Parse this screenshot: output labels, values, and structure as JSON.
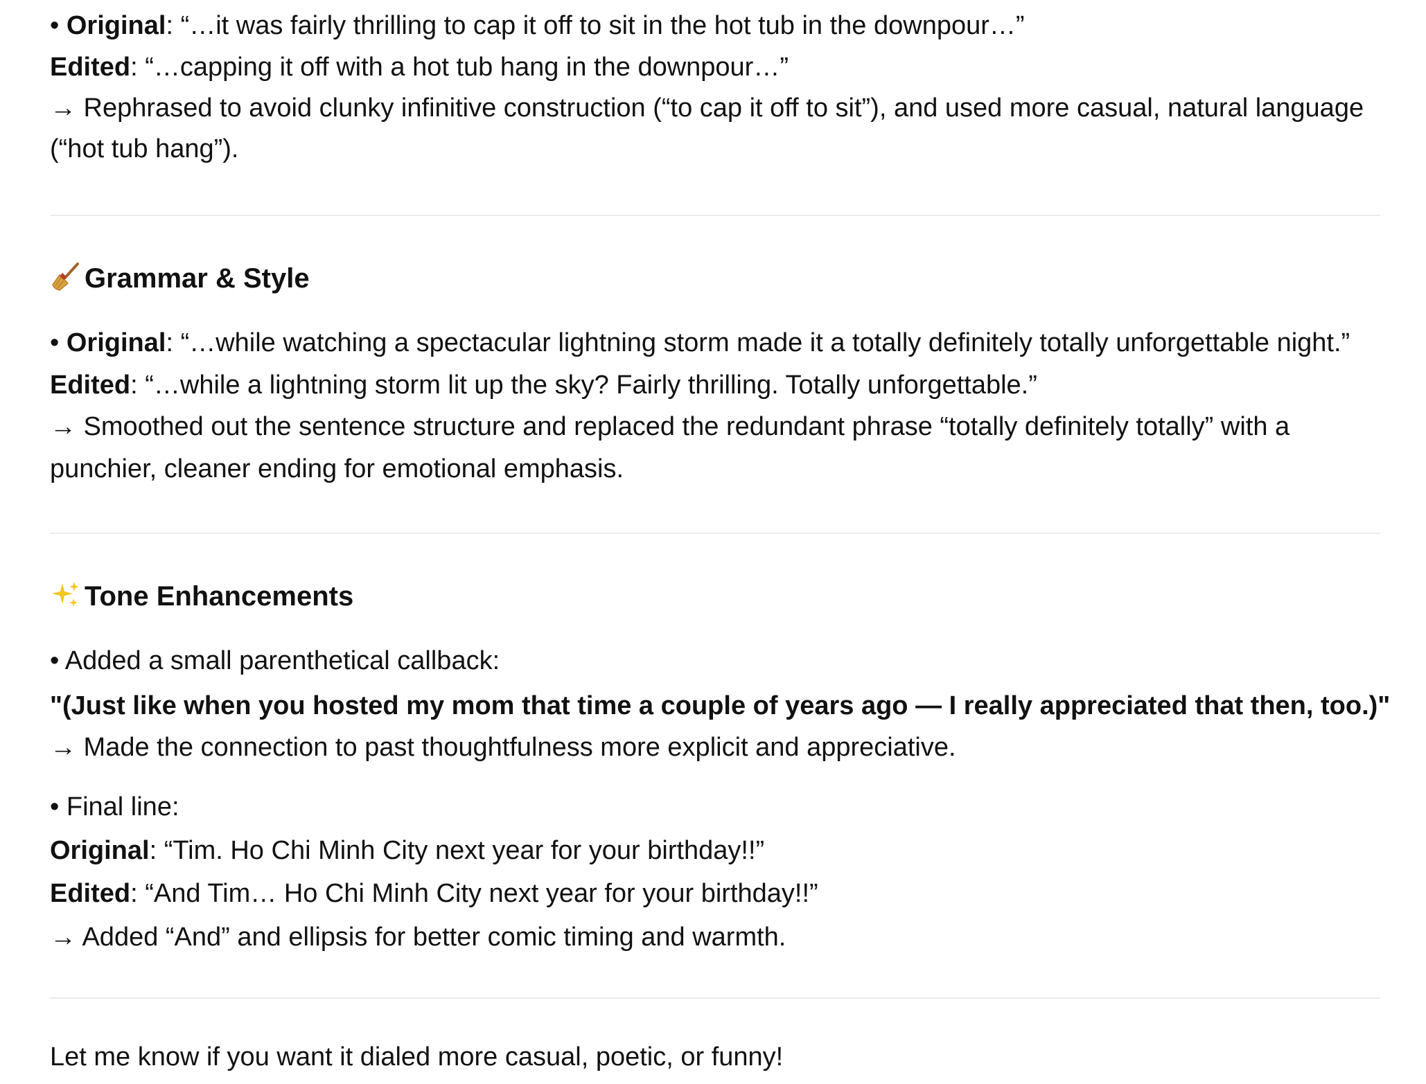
{
  "sections": {
    "clarity": {
      "item1": {
        "bullet": "•",
        "original_label": "Original",
        "original_text": ": “…it was fairly thrilling to cap it off to sit in the hot tub in the downpour…”",
        "edited_label": "Edited",
        "edited_text": ": “…capping it off with a hot tub hang in the downpour…”",
        "note_line1": "→ Rephrased to avoid clunky infinitive construction (“to cap it off to sit”), and used more casual, natural language",
        "note_line2": "(“hot tub hang”)."
      }
    },
    "grammar": {
      "icon": "broom-icon",
      "title": "Grammar & Style",
      "item1": {
        "bullet": "•",
        "original_label": "Original",
        "original_text": ": “…while watching a spectacular lightning storm made it a totally definitely totally unforgettable night.”",
        "edited_label": "Edited",
        "edited_text": ": “…while a lightning storm lit up the sky? Fairly thrilling. Totally unforgettable.”",
        "note_line1": "→ Smoothed out the sentence structure and replaced the redundant phrase “totally definitely totally” with a",
        "note_line2": "punchier, cleaner ending for emotional emphasis."
      }
    },
    "tone": {
      "icon": "sparkles-icon",
      "title": "Tone Enhancements",
      "item1": {
        "bullet": "•",
        "text": "Added a small parenthetical callback:",
        "quote": "\"(Just like when you hosted my mom that time a couple of years ago — I really appreciated that then, too.)\"",
        "note": "→ Made the connection to past thoughtfulness more explicit and appreciative."
      },
      "item2": {
        "bullet": "•",
        "text": "Final line:",
        "original_label": "Original",
        "original_text": ": “Tim. Ho Chi Minh City next year for your birthday!!”",
        "edited_label": "Edited",
        "edited_text": ": “And Tim… Ho Chi Minh City next year for your birthday!!”",
        "note": "→ Added “And” and ellipsis for better comic timing and warmth."
      }
    }
  },
  "closing": "Let me know if you want it dialed more casual, poetic, or funny!",
  "colors": {
    "text": "#111111",
    "divider": "#ececec"
  }
}
